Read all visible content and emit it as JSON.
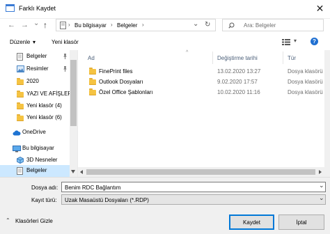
{
  "window": {
    "title": "Farklı Kaydet",
    "close_glyph": "✕"
  },
  "nav": {
    "back_glyph": "←",
    "forward_glyph": "→",
    "recent_glyph": "⌄",
    "up_glyph": "↑",
    "breadcrumb": [
      "Bu bilgisayar",
      "Belgeler"
    ],
    "separator": "›",
    "refresh_glyph": "↻",
    "search_placeholder": "Ara: Belgeler"
  },
  "toolbar": {
    "organize": "Düzenle",
    "organize_arrow": "▾",
    "new_folder": "Yeni klasör",
    "help_glyph": "?"
  },
  "sidebar": {
    "items": [
      {
        "label": "Belgeler",
        "icon": "documents-icon",
        "pinned": true
      },
      {
        "label": "Resimler",
        "icon": "pictures-icon",
        "pinned": true
      },
      {
        "label": "2020",
        "icon": "folder-icon"
      },
      {
        "label": "YAZI VE AFİŞLER",
        "icon": "folder-icon"
      },
      {
        "label": "Yeni klasör (4)",
        "icon": "folder-icon"
      },
      {
        "label": "Yeni klasör (6)",
        "icon": "folder-icon"
      },
      {
        "label": "OneDrive",
        "icon": "cloud-icon"
      },
      {
        "label": "Bu bilgisayar",
        "icon": "computer-icon"
      },
      {
        "label": "3D Nesneler",
        "icon": "cube-icon"
      },
      {
        "label": "Belgeler",
        "icon": "documents-icon",
        "selected": true
      }
    ]
  },
  "columns": {
    "name": "Ad",
    "date": "Değiştirme tarihi",
    "type": "Tür",
    "sort_glyph": "^"
  },
  "files": [
    {
      "name": "FinePrint files",
      "date": "13.02.2020 13:27",
      "type": "Dosya klasörü"
    },
    {
      "name": "Outlook Dosyaları",
      "date": "9.02.2020 17:57",
      "type": "Dosya klasörü"
    },
    {
      "name": "Özel Office Şablonları",
      "date": "10.02.2020 11:16",
      "type": "Dosya klasörü"
    }
  ],
  "form": {
    "filename_label": "Dosya adı:",
    "filename_value": "Benim RDC Bağlantım",
    "filetype_label": "Kayıt türü:",
    "filetype_value": "Uzak Masaüstü Dosyaları (*.RDP)",
    "dropdown_glyph": "⌄"
  },
  "footer": {
    "hide_folders": "Klasörleri Gizle",
    "hide_folders_glyph": "⌃",
    "save": "Kaydet",
    "cancel": "İptal"
  },
  "colors": {
    "selection": "#cce8ff",
    "header_text": "#4c607a",
    "primary_border": "#0078d7",
    "folder": "#f5c342"
  }
}
